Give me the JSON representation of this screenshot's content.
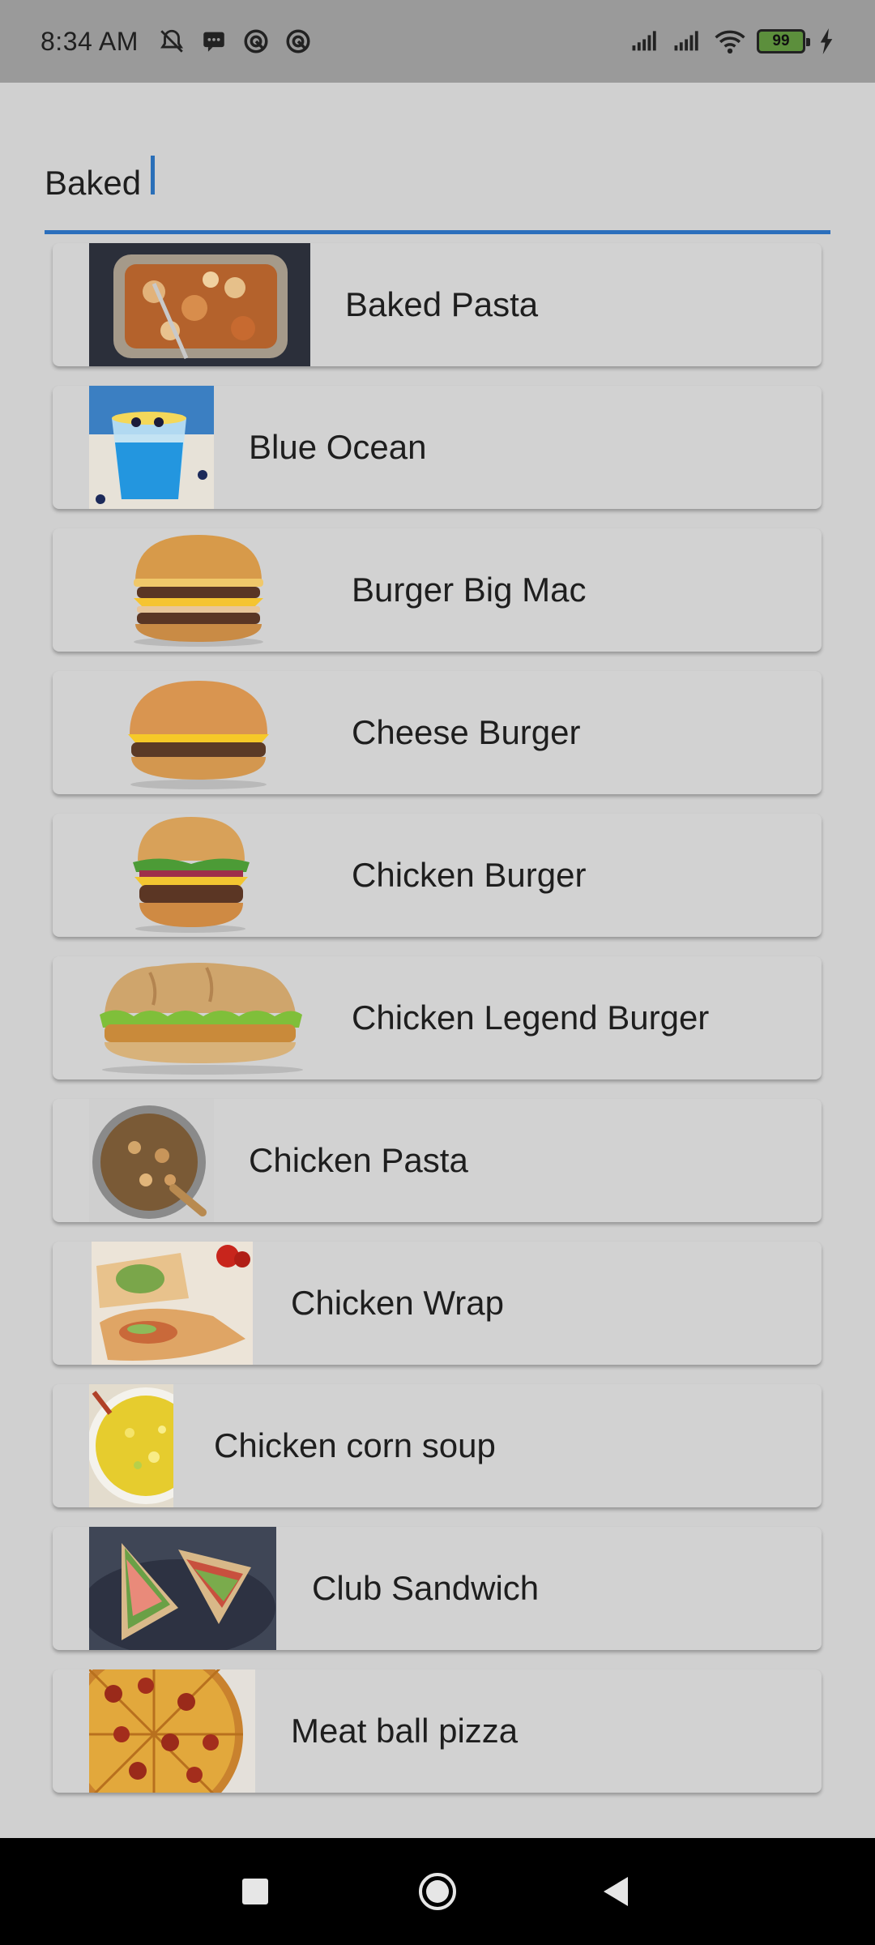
{
  "status_bar": {
    "time": "8:34 AM",
    "battery_level": "99",
    "left_icons": [
      "bell-off-icon",
      "message-icon",
      "app-icon-1",
      "app-icon-2"
    ],
    "right_icons": [
      "signal-icon",
      "signal-icon-2",
      "wifi-icon",
      "battery-icon",
      "charging-icon"
    ]
  },
  "search": {
    "value": "Baked ",
    "accent_color": "#2b6fbc"
  },
  "items": [
    {
      "name": "Baked Pasta",
      "image": "baked-pasta-image"
    },
    {
      "name": "Blue Ocean",
      "image": "blue-ocean-image"
    },
    {
      "name": "Burger Big Mac",
      "image": "burger-big-mac-image"
    },
    {
      "name": "Cheese Burger",
      "image": "cheese-burger-image"
    },
    {
      "name": "Chicken Burger",
      "image": "chicken-burger-image"
    },
    {
      "name": "Chicken Legend Burger",
      "image": "chicken-legend-burger-image"
    },
    {
      "name": "Chicken Pasta",
      "image": "chicken-pasta-image"
    },
    {
      "name": "Chicken Wrap",
      "image": "chicken-wrap-image"
    },
    {
      "name": "Chicken corn soup",
      "image": "chicken-corn-soup-image"
    },
    {
      "name": "Club Sandwich",
      "image": "club-sandwich-image"
    },
    {
      "name": "Meat ball pizza",
      "image": "meat-ball-pizza-image"
    }
  ],
  "nav": {
    "buttons": [
      "recents-square-icon",
      "home-circle-icon",
      "back-triangle-icon"
    ]
  }
}
